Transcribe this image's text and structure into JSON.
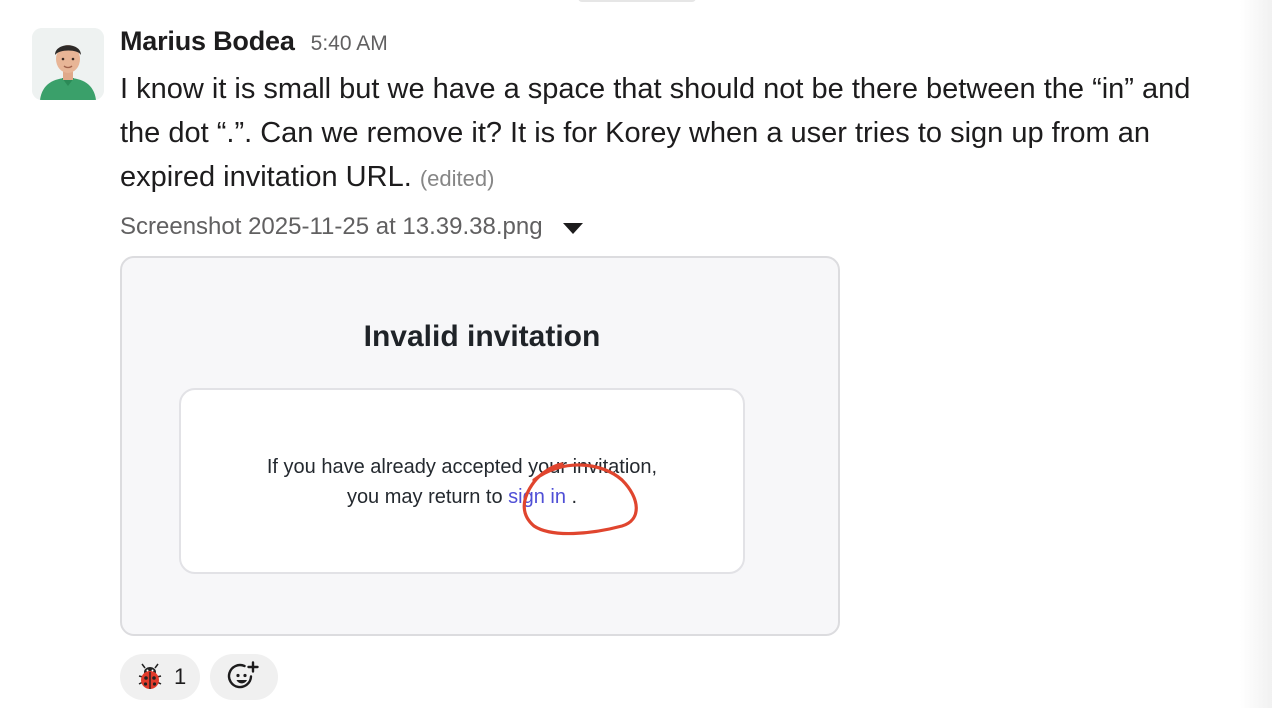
{
  "message": {
    "author": "Marius Bodea",
    "timestamp": "5:40 AM",
    "text": "I know it is small but we have a space that should not be there between the “in” and the dot “.”. Can we remove it? It is for Korey when a user tries to sign up from an expired invitation URL.",
    "edited_label": "(edited)",
    "avatar_icon": "person-avatar"
  },
  "attachment": {
    "filename": "Screenshot 2025-11-25 at 13.39.38.png",
    "toggle_icon": "caret-down-icon",
    "preview": {
      "title": "Invalid invitation",
      "line1": "If you have already accepted your invitation,",
      "line2_prefix": "you may return to ",
      "link_text": "sign in",
      "line2_suffix": " .",
      "annotation_color": "#e0452e"
    }
  },
  "reactions": [
    {
      "emoji_icon": "ladybug-icon",
      "count": "1"
    }
  ],
  "add_reaction_icon": "add-emoji-icon",
  "colors": {
    "text": "#1d1c1d",
    "muted": "#616061",
    "link": "#4f4fd6"
  }
}
